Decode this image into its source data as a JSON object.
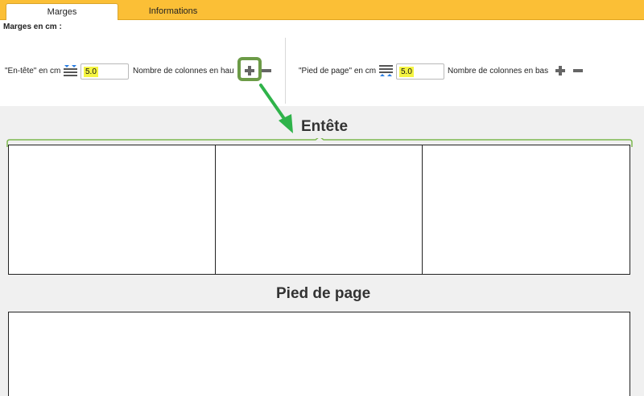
{
  "tabs": [
    {
      "label": "Marges",
      "active": true
    },
    {
      "label": "Informations",
      "active": false
    }
  ],
  "settings": {
    "section_title": "Marges en cm :",
    "header_label": "\"En-tête\" en cm",
    "header_value": "5.0",
    "header_columns_label": "Nombre de colonnes en haut",
    "footer_label": "\"Pied de page\" en cm",
    "footer_value": "5.0",
    "footer_columns_label": "Nombre de colonnes en bas"
  },
  "preview": {
    "header_title": "Entête",
    "header_columns": 3,
    "footer_title": "Pied de page",
    "footer_columns": 1
  },
  "colors": {
    "tab_bar": "#fbbf36",
    "highlight": "#6c9b47",
    "arrow": "#2fb34a",
    "input_highlight": "#f5f542"
  }
}
